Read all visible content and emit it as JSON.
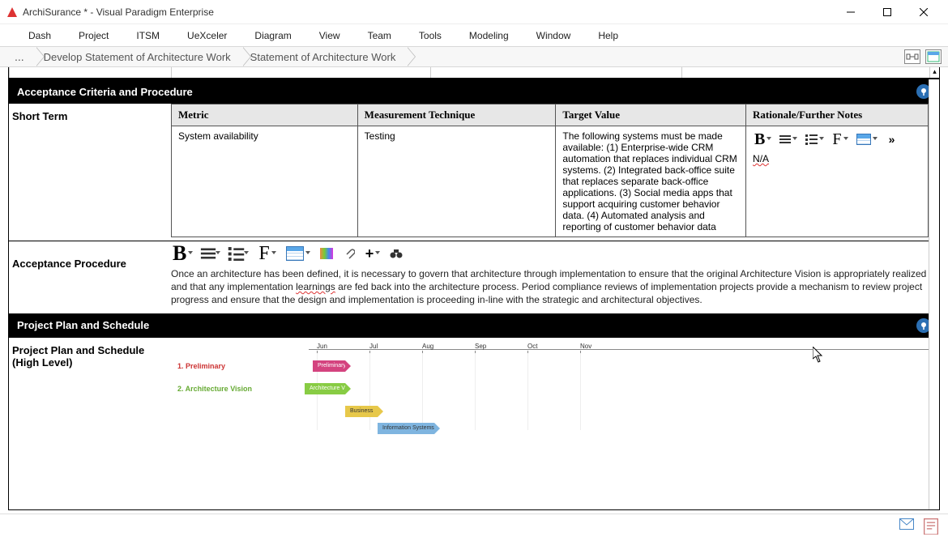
{
  "window": {
    "title": "ArchiSurance * - Visual Paradigm Enterprise"
  },
  "menu": [
    "Dash",
    "Project",
    "ITSM",
    "UeXceler",
    "Diagram",
    "View",
    "Team",
    "Tools",
    "Modeling",
    "Window",
    "Help"
  ],
  "breadcrumb": {
    "root": "...",
    "items": [
      "Develop Statement of Architecture Work",
      "Statement of Architecture Work"
    ]
  },
  "criteria": {
    "heading": "Acceptance Criteria and Procedure",
    "short_term_label": "Short Term",
    "columns": [
      "Metric",
      "Measurement Technique",
      "Target Value",
      "Rationale/Further Notes"
    ],
    "row": {
      "metric": "System availability",
      "technique": "Testing",
      "target": "The following systems must be made available: (1) Enterprise-wide CRM automation that replaces individual CRM systems. (2) Integrated back-office suite that replaces separate back-office applications. (3) Social media apps that support acquiring customer behavior data. (4) Automated analysis and reporting of customer behavior data",
      "rationale": "N/A"
    }
  },
  "procedure": {
    "label": "Acceptance Procedure",
    "text_pre": "Once an architecture has been defined, it is necessary to govern that architecture through implementation to ensure that the original Architecture Vision is appropriately realized and that any implementation ",
    "text_squig": "learnings",
    "text_post": " are fed back into the architecture process. Period compliance reviews of implementation projects provide a mechanism to review project progress and ensure that the design and implementation is proceeding in-line with the strategic and architectural objectives."
  },
  "plan": {
    "heading": "Project Plan and Schedule",
    "label_line1": "Project Plan and Schedule",
    "label_line2": "(High Level)",
    "months": [
      "Jun",
      "Jul",
      "Aug",
      "Sep",
      "Oct",
      "Nov"
    ],
    "rows": [
      {
        "label": "1. Preliminary",
        "bar_label": "Preliminary"
      },
      {
        "label": "2. Architecture Vision",
        "bar_label": "Architecture Vi..."
      },
      {
        "label": "",
        "bar_label": "Business"
      },
      {
        "label": "",
        "bar_label": "Information Systems"
      }
    ]
  }
}
